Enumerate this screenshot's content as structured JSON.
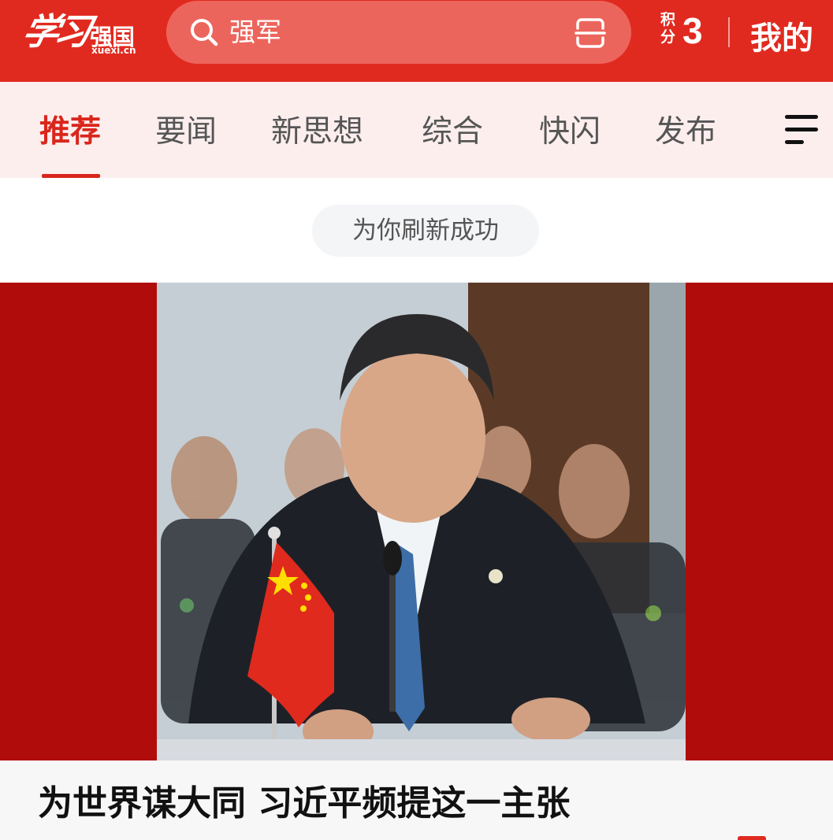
{
  "header": {
    "logo_script": "学习",
    "logo_name": "强国",
    "logo_url": "xuexi.cn",
    "search_value": "强军",
    "points_label": "积分",
    "points_value": "3",
    "mine_label": "我的"
  },
  "tabs": [
    {
      "label": "推荐",
      "active": true
    },
    {
      "label": "要闻",
      "active": false
    },
    {
      "label": "新思想",
      "active": false
    },
    {
      "label": "综合",
      "active": false
    },
    {
      "label": "快闪",
      "active": false
    },
    {
      "label": "发布",
      "active": false
    }
  ],
  "toast": "为你刷新成功",
  "feed": {
    "headline": "为世界谋大同 习近平频提这一主张"
  },
  "icons": {
    "search": "search-icon",
    "scan": "scan-icon",
    "menu": "menu-icon"
  },
  "colors": {
    "brand_red": "#e12a1f",
    "tab_active": "#d9261c",
    "hero_background": "#b10c0c"
  }
}
